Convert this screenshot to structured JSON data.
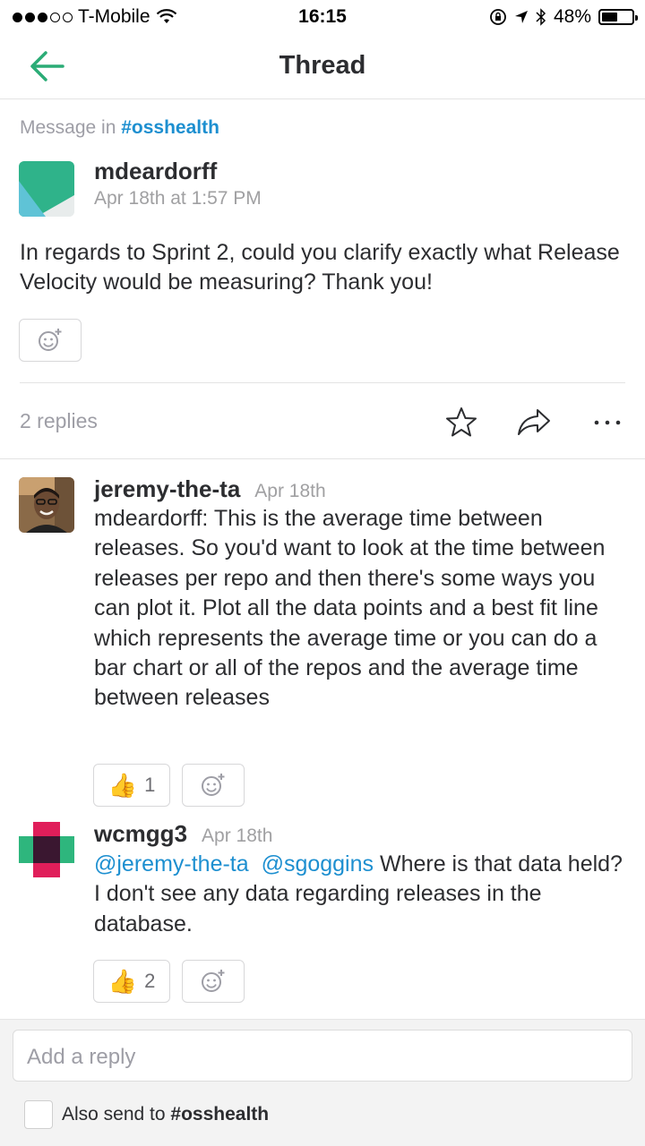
{
  "status_bar": {
    "carrier": "T-Mobile",
    "time": "16:15",
    "battery": "48%"
  },
  "header": {
    "title": "Thread"
  },
  "context": {
    "prefix": "Message in",
    "channel": "#osshealth"
  },
  "parent": {
    "author": "mdeardorff",
    "timestamp": "Apr 18th at 1:57 PM",
    "text": "In regards to Sprint 2, could you clarify exactly what Release Velocity would be measuring? Thank you!"
  },
  "replies_label": "2 replies",
  "replies": [
    {
      "author": "jeremy-the-ta",
      "timestamp": "Apr 18th",
      "text": "mdeardorff: This is the average time between releases. So you'd want to look at the time between releases per repo and then there's some ways you can plot it. Plot all the data points and a best fit line which represents the average time or you can do a bar chart or all of the repos and the average time between releases",
      "thumbs_count": "1"
    },
    {
      "author": "wcmgg3",
      "timestamp": "Apr 18th",
      "mention1": "@jeremy-the-ta",
      "mention2": "@sgoggins",
      "text": "Where is that data held? I don't see any data regarding releases in the database.",
      "thumbs_count": "2"
    }
  ],
  "composer": {
    "placeholder": "Add a reply",
    "also_send_prefix": "Also send to",
    "also_send_channel": "#osshealth"
  },
  "colors": {
    "accent": "#1d8fd0",
    "back_arrow": "#2bac76",
    "wcmgg3_pink": "#e01e5a",
    "wcmgg3_green": "#2eb67d"
  }
}
